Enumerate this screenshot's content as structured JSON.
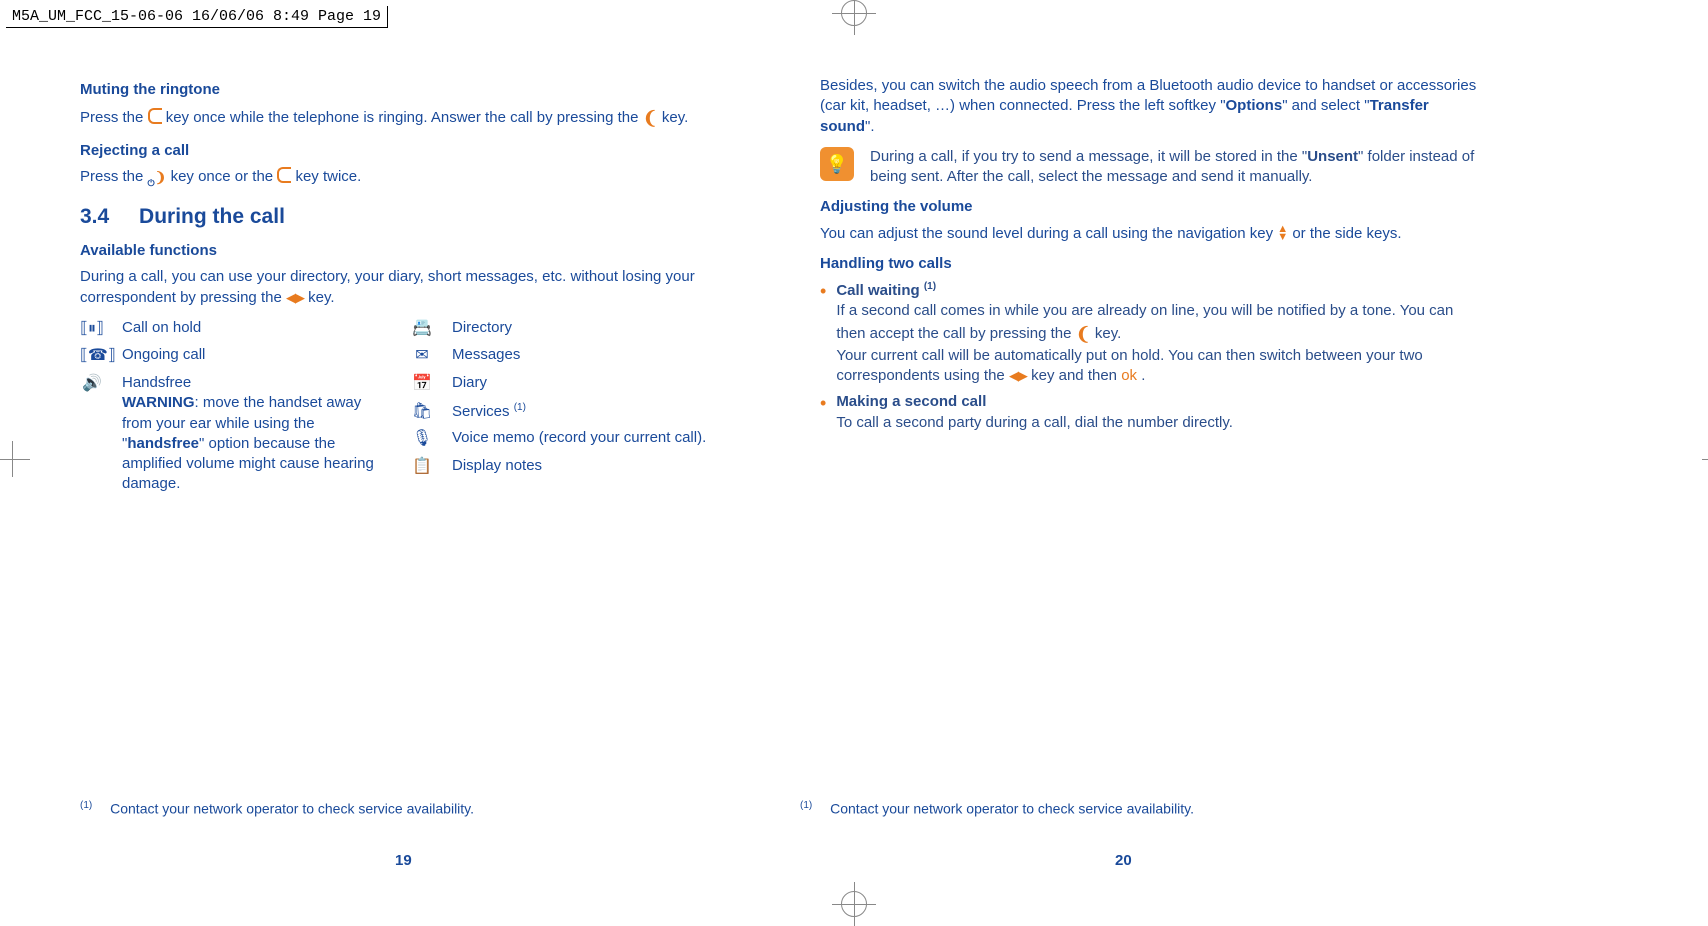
{
  "header": "M5A_UM_FCC_15-06-06  16/06/06  8:49  Page 19",
  "left": {
    "h_muting": "Muting the ringtone",
    "muting_text_a": "Press the ",
    "muting_text_b": " key once while the telephone is ringing. Answer the call by pressing the ",
    "muting_text_c": " key.",
    "h_rejecting": "Rejecting a call",
    "rejecting_a": "Press the ",
    "rejecting_b": " key once or the ",
    "rejecting_c": " key twice.",
    "section_num": "3.4",
    "section_title": "During the call",
    "h_available": "Available functions",
    "available_p_a": "During a call, you can use your directory, your diary, short messages, etc. without losing your correspondent by pressing the ",
    "available_p_b": " key.",
    "col1": {
      "i1": "Call on hold",
      "i2": "Ongoing call",
      "i3": "Handsfree",
      "warn_label": "WARNING",
      "warn_text": ": move the handset away from your ear while using the \"",
      "warn_bold": "handsfree",
      "warn_text2": "\" option because the amplified volume might cause hearing damage."
    },
    "col2": {
      "i1": "Directory",
      "i2": "Messages",
      "i3": "Diary",
      "i4": "Services ",
      "i5": "Voice memo (record your current call).",
      "i6": "Display notes"
    }
  },
  "right": {
    "intro_a": "Besides, you can switch the audio speech from a Bluetooth audio device to handset or accessories (car kit, headset, …) when connected. Press the left softkey \"",
    "intro_b": "Options",
    "intro_c": "\" and select \"",
    "intro_d": "Transfer sound",
    "intro_e": "\".",
    "tip_a": "During a call, if you try to send a message, it will be stored in the \"",
    "tip_b": "Unsent",
    "tip_c": "\" folder instead of being sent. After the call, select the message and send it manually.",
    "h_volume": "Adjusting the volume",
    "volume_a": "You can adjust the sound level during a call using the navigation key ",
    "volume_b": " or the side keys.",
    "h_two": "Handling two calls",
    "cw_title": "Call waiting ",
    "cw_a": "If a second call comes in while you are already on line, you will be notified by a tone. You can then accept the call by pressing the ",
    "cw_b": " key.",
    "cw_c": "Your current call will be automatically put on hold. You can then switch between your two correspondents using the ",
    "cw_d": " key and then ",
    "cw_e": ".",
    "mk_title": "Making a second call",
    "mk_text": "To call a second party during a call, dial the number directly."
  },
  "footnote_marker": "(1)",
  "footnote_text": "Contact your network operator to check service availability.",
  "page_left": "19",
  "page_right": "20",
  "sup1": "(1)"
}
